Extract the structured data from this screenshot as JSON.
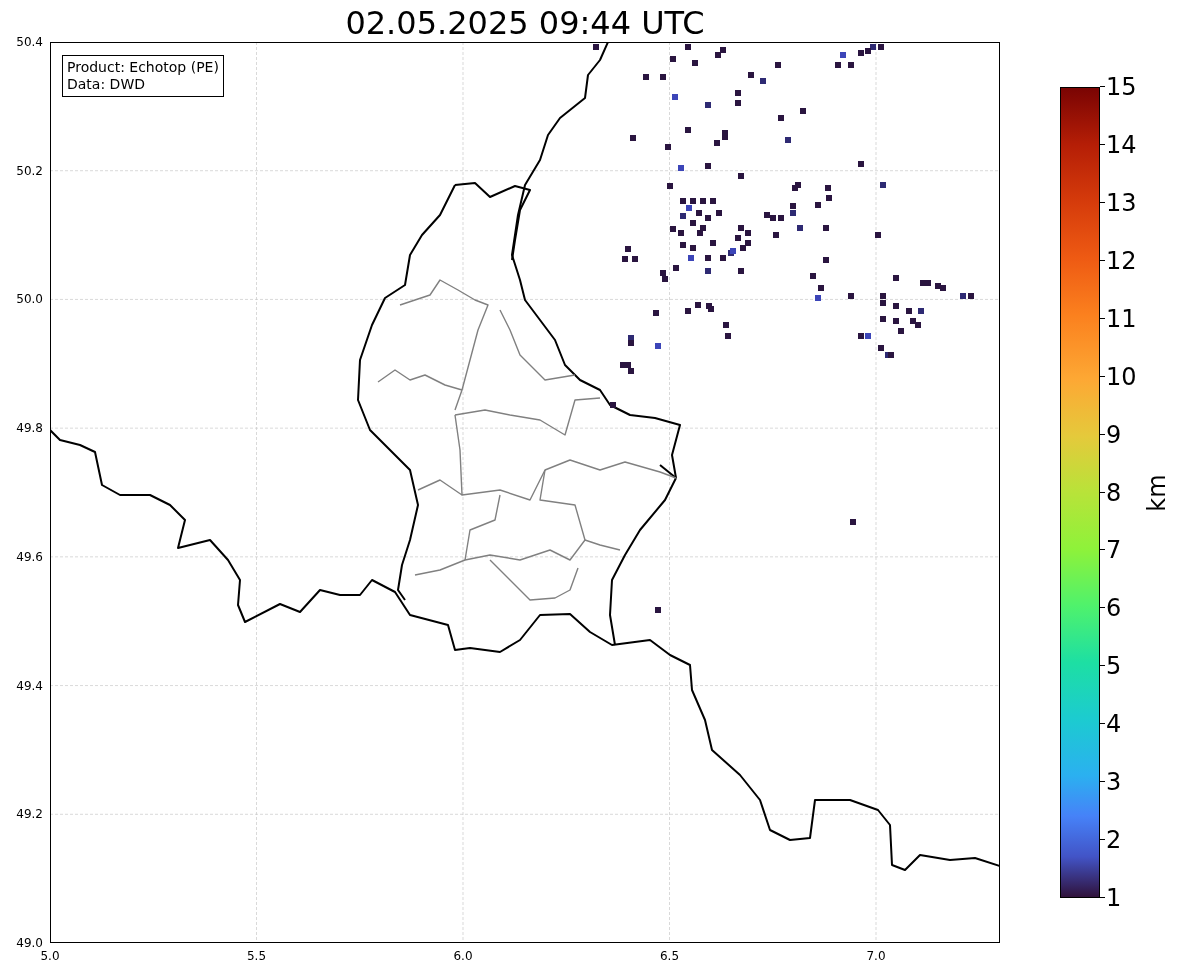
{
  "title": "02.05.2025 09:44 UTC",
  "legend": [
    "Product: Echotop (PE)",
    "Data: DWD"
  ],
  "map": {
    "y_ticks": [
      "50.4",
      "50.2",
      "50.0",
      "49.8",
      "49.6",
      "49.4",
      "49.2",
      "49.0"
    ],
    "x_ticks": [
      "5.0",
      "5.5",
      "6.0",
      "6.5",
      "7.0"
    ]
  },
  "colorbar": {
    "ticks": [
      "15",
      "14",
      "13",
      "12",
      "11",
      "10",
      "9",
      "8",
      "7",
      "6",
      "5",
      "4",
      "3",
      "2",
      "1"
    ],
    "label": "km"
  }
}
